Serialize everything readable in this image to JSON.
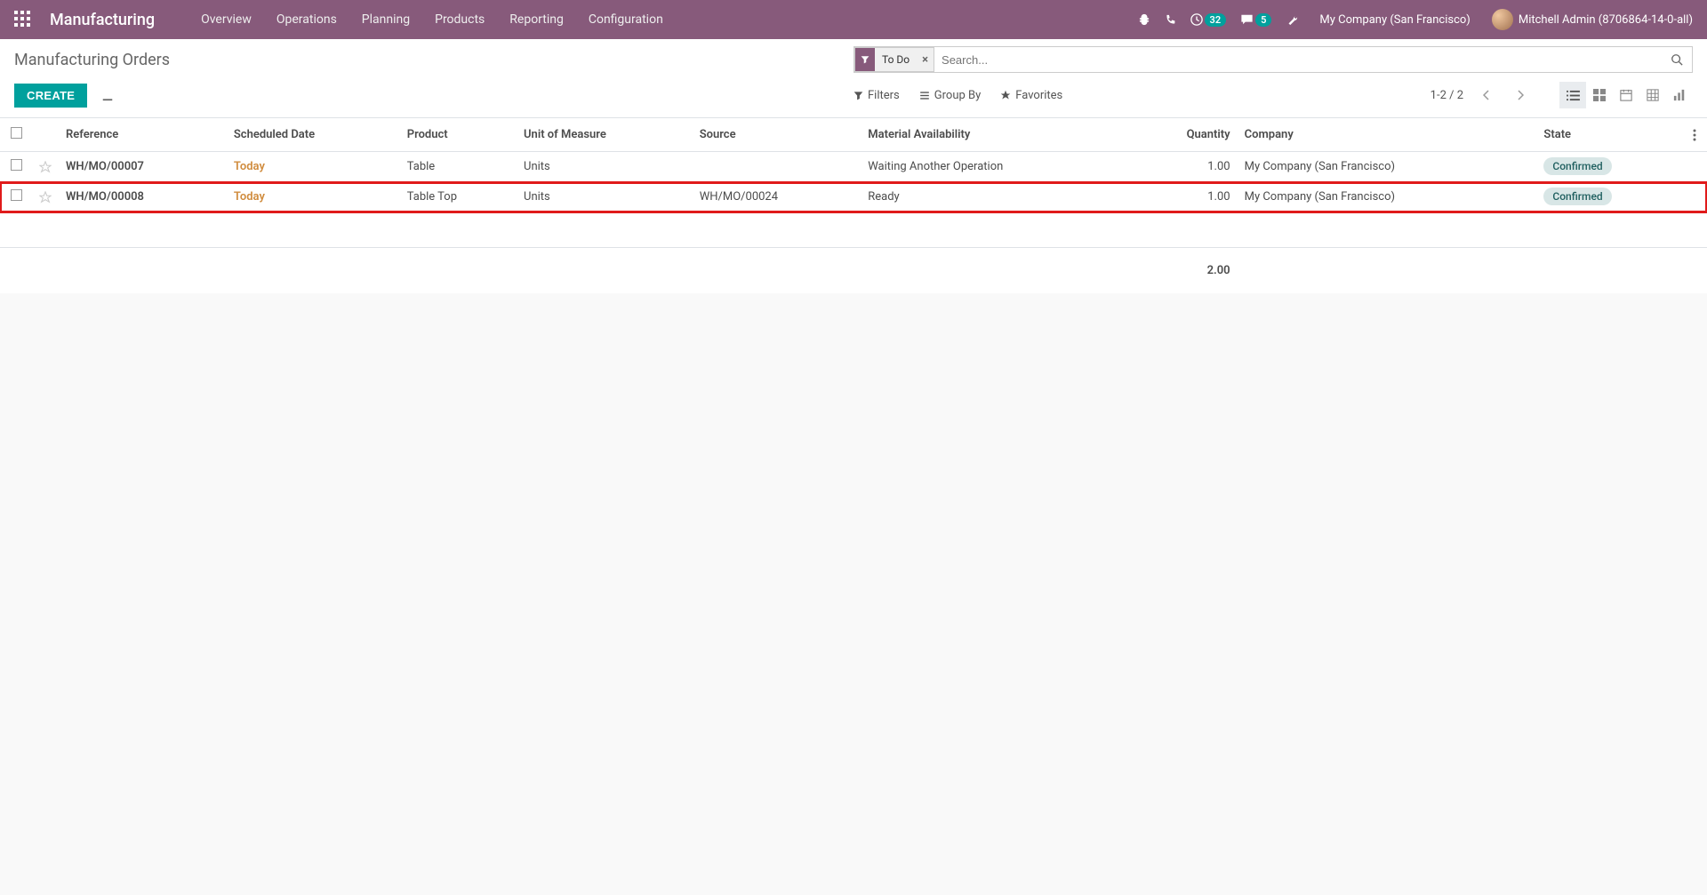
{
  "navbar": {
    "brand": "Manufacturing",
    "menu": [
      "Overview",
      "Operations",
      "Planning",
      "Products",
      "Reporting",
      "Configuration"
    ],
    "activities_count": "32",
    "messages_count": "5",
    "company": "My Company (San Francisco)",
    "user": "Mitchell Admin (8706864-14-0-all)"
  },
  "breadcrumb": "Manufacturing Orders",
  "search": {
    "facet_label": "To Do",
    "placeholder": "Search..."
  },
  "buttons": {
    "create": "CREATE",
    "filters": "Filters",
    "groupby": "Group By",
    "favorites": "Favorites"
  },
  "pager": "1-2 / 2",
  "columns": {
    "reference": "Reference",
    "scheduled_date": "Scheduled Date",
    "product": "Product",
    "uom": "Unit of Measure",
    "source": "Source",
    "material_availability": "Material Availability",
    "quantity": "Quantity",
    "company": "Company",
    "state": "State"
  },
  "rows": [
    {
      "reference": "WH/MO/00007",
      "scheduled_date": "Today",
      "product": "Table",
      "uom": "Units",
      "source": "",
      "material_availability": "Waiting Another Operation",
      "quantity": "1.00",
      "company": "My Company (San Francisco)",
      "state": "Confirmed",
      "highlight": false
    },
    {
      "reference": "WH/MO/00008",
      "scheduled_date": "Today",
      "product": "Table Top",
      "uom": "Units",
      "source": "WH/MO/00024",
      "material_availability": "Ready",
      "quantity": "1.00",
      "company": "My Company (San Francisco)",
      "state": "Confirmed",
      "highlight": true
    }
  ],
  "totals": {
    "quantity": "2.00"
  }
}
